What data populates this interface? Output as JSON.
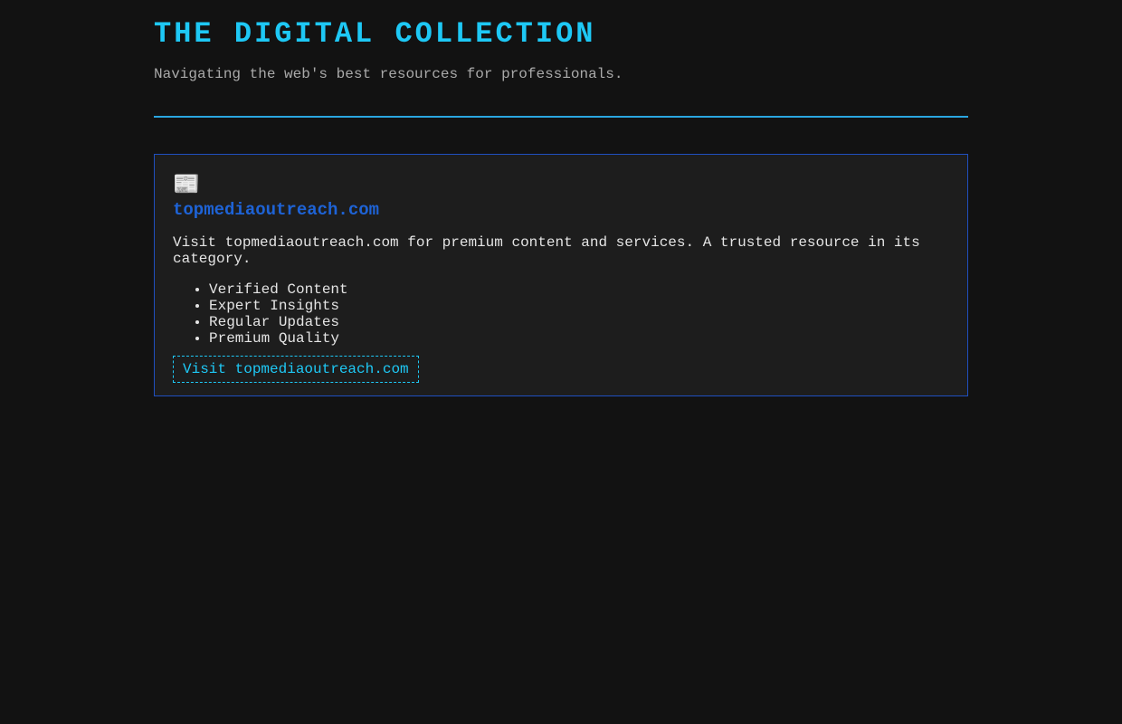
{
  "header": {
    "title": "THE DIGITAL COLLECTION",
    "tagline": "Navigating the web's best resources for professionals."
  },
  "card": {
    "icon": "newspaper-icon",
    "icon_glyph": "📰",
    "title": "topmediaoutreach.com",
    "description": "Visit topmediaoutreach.com for premium content and services. A trusted resource in its category.",
    "features": [
      "Verified Content",
      "Expert Insights",
      "Regular Updates",
      "Premium Quality"
    ],
    "button_label": "Visit topmediaoutreach.com"
  },
  "colors": {
    "background": "#121212",
    "accent": "#1ec8f5",
    "card_border": "#1f4fbf",
    "link": "#1e63d6"
  }
}
